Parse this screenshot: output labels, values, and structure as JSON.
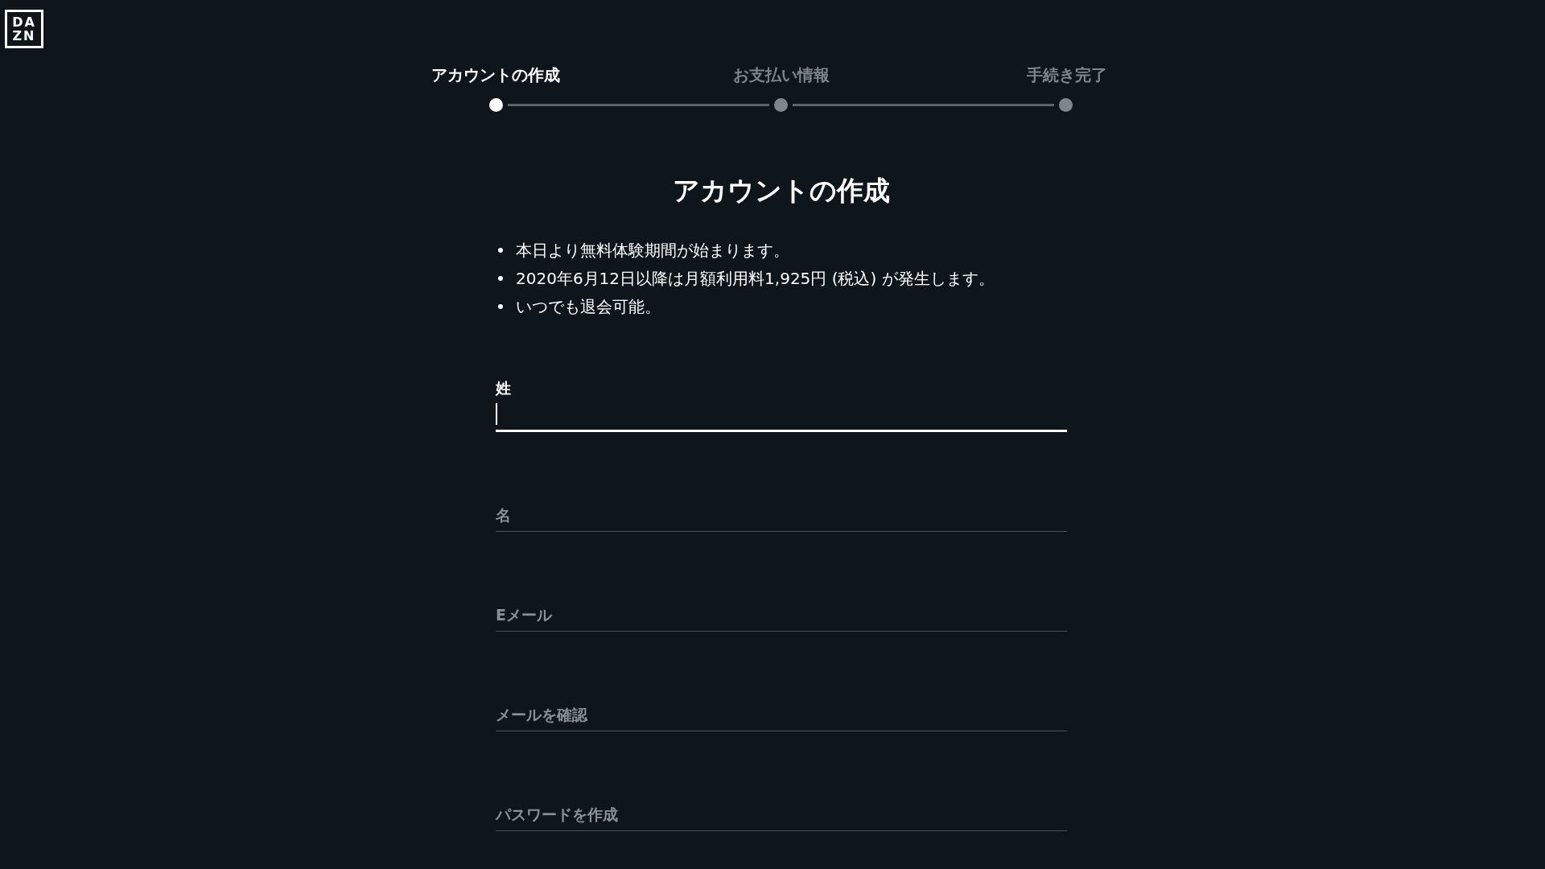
{
  "logo": {
    "lines": [
      "DA",
      "ZN"
    ]
  },
  "steps": [
    {
      "label": "アカウントの作成",
      "selected": true
    },
    {
      "label": "お支払い情報",
      "selected": false
    },
    {
      "label": "手続き完了",
      "selected": false
    }
  ],
  "title": "アカウントの作成",
  "notes": [
    "本日より無料体験期間が始まります。",
    "2020年6月12日以降は月額利用料1,925円 (税込) が発生します。",
    "いつでも退会可能。"
  ],
  "fields": [
    {
      "label": "姓",
      "focused": true
    },
    {
      "label": "名",
      "focused": false
    },
    {
      "label": "Eメール",
      "focused": false
    },
    {
      "label": "メールを確認",
      "focused": false
    },
    {
      "label": "パスワードを作成",
      "focused": false
    }
  ]
}
